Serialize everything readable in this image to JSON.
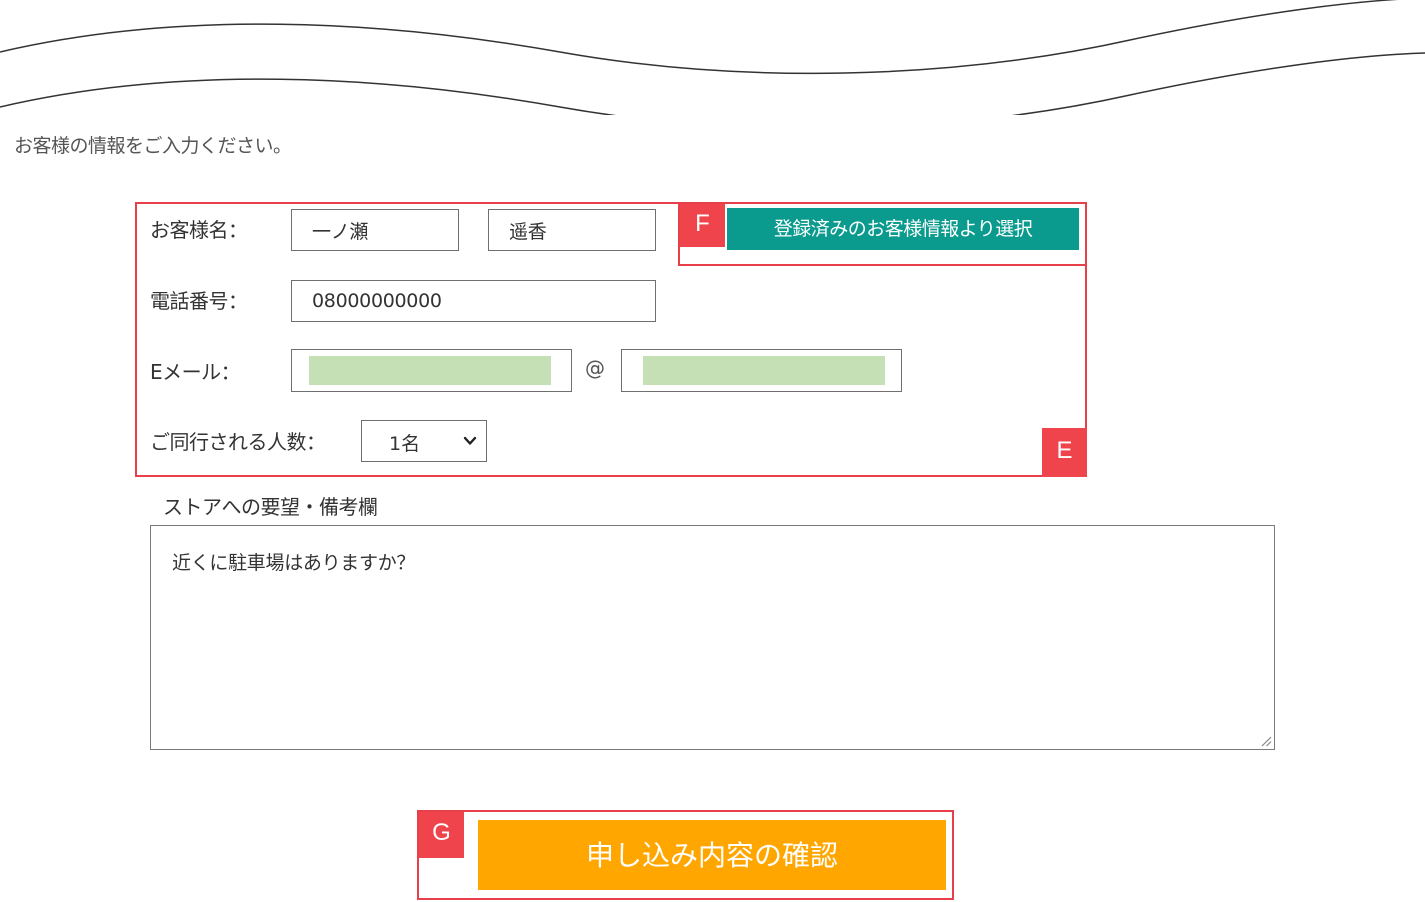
{
  "intro": {
    "text": "お客様の情報をご入力ください。"
  },
  "form": {
    "name_label": "お客様名：",
    "last_name_value": "一ノ瀬",
    "first_name_value": "遥香",
    "select_registered_button": "登録済みのお客様情報より選択",
    "phone_label": "電話番号：",
    "phone_value": "08000000000",
    "email_label": "Eメール：",
    "email_at": "@",
    "party_size_label": "ご同行される人数：",
    "party_size_value": "1名"
  },
  "notes": {
    "label": "ストアへの要望・備考欄",
    "value": "近くに駐車場はありますか？"
  },
  "confirm_button": {
    "label": "申し込み内容の確認"
  },
  "annotations": {
    "e": "E",
    "f": "F",
    "g": "G"
  },
  "colors": {
    "teal_button": "#0b9b8e",
    "confirm_button": "#ffa600",
    "highlight": "#e8404a",
    "redacted_fill": "#c5e0b4"
  }
}
